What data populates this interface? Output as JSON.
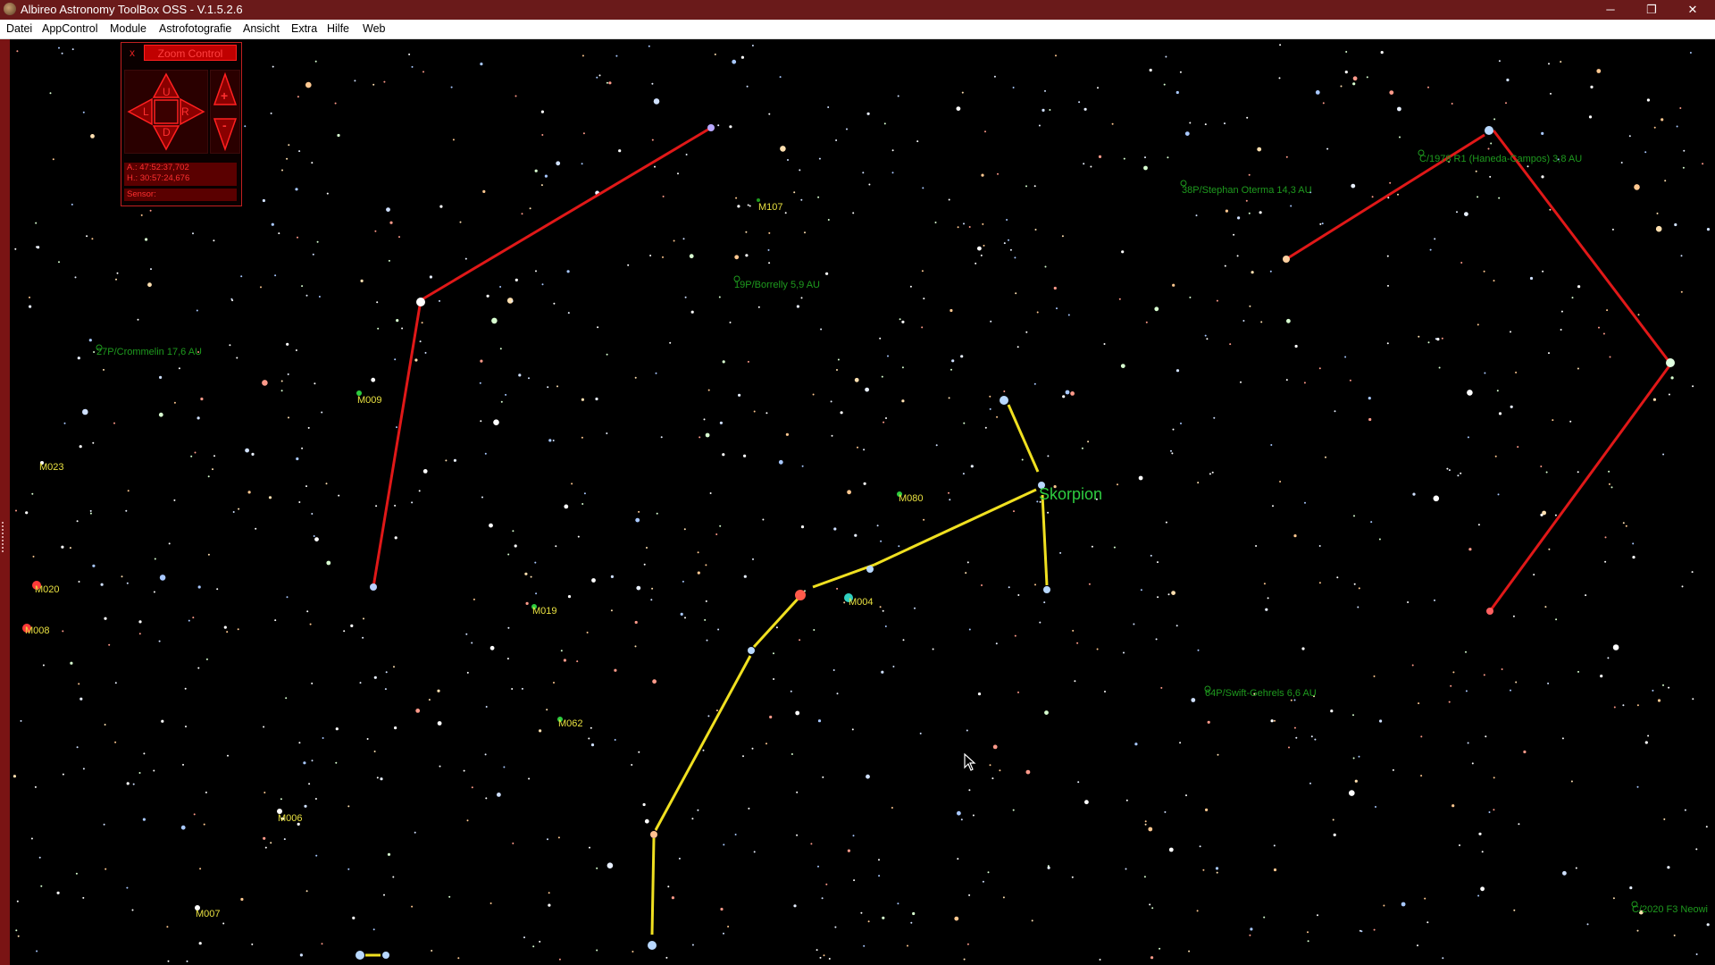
{
  "window": {
    "title": "Albireo Astronomy ToolBox OSS - V.1.5.2.6",
    "minimize": "─",
    "restore": "❐",
    "close": "✕"
  },
  "menu": [
    "Datei",
    "AppControl",
    "Module",
    "Astrofotografie",
    "Ansicht",
    "Extra",
    "Hilfe",
    "Web"
  ],
  "zoom_control": {
    "close": "x",
    "title": "Zoom Control",
    "dpad": {
      "up": "U",
      "down": "D",
      "left": "L",
      "right": "R"
    },
    "zoom_in": "+",
    "zoom_out": "-",
    "coord_a": "A.: 47:52:37,702",
    "coord_h": "H.: 30:57:24,676",
    "sensor": "Sensor:"
  },
  "sky_labels": {
    "constellation": "Skorpion",
    "m107": "M107",
    "m009": "M009",
    "m023": "M023",
    "m020": "M020",
    "m008": "M008",
    "m080": "M080",
    "m004": "M004",
    "m019": "M019",
    "m062": "M062",
    "m006": "M006",
    "m007": "M007",
    "c_crommelin": "27P/Crommelin 17,6 AU",
    "c_borrelly": "19P/Borrelly 5,9 AU",
    "c_stephan": "38P/Stephan Oterma 14,3 AU",
    "c_haneda": "C/1978 R1 (Haneda-Campos) 3,8 AU",
    "c_swift": "64P/Swift-Gehrels 6,6 AU",
    "c_neowise": "C/2020 F3 Neowi"
  },
  "colors": {
    "title_bar": "#6a1a1a",
    "constellation_line_yellow": "#f0e020",
    "constellation_line_red": "#e01818",
    "messier_label": "#e8e040",
    "comet_label": "#1e9a1e",
    "constellation_label": "#2ecc40",
    "panel_red": "#c00000"
  },
  "icons": {
    "app": "albireo-app-icon",
    "cursor": "mouse-pointer-icon"
  }
}
